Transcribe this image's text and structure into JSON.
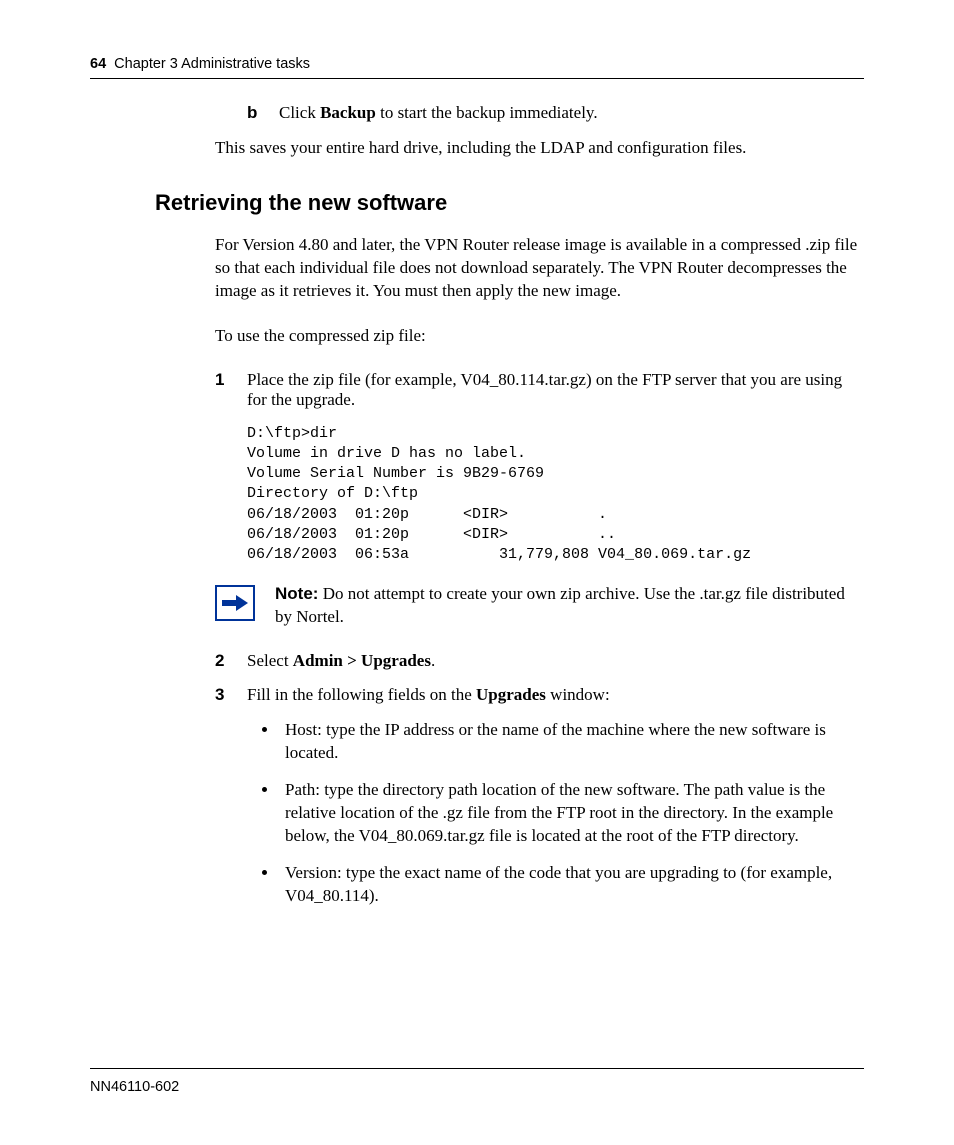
{
  "header": {
    "page_number": "64",
    "chapter": "Chapter 3  Administrative tasks"
  },
  "step_b": {
    "label": "b",
    "pre": "Click ",
    "bold": "Backup",
    "post": " to start the backup immediately."
  },
  "para_save": "This saves your entire hard drive, including the LDAP and configuration files.",
  "section_title": "Retrieving the new software",
  "para_intro": "For Version 4.80 and later, the VPN Router release image is available in a compressed .zip file so that each individual file does not download separately. The VPN Router decompresses the image as it retrieves it. You must then apply the new image.",
  "para_touse": "To use the compressed zip file:",
  "step1": {
    "label": "1",
    "text": "Place the zip file (for example, V04_80.114.tar.gz) on the FTP server that you are using for the upgrade."
  },
  "code_block": "D:\\ftp>dir\nVolume in drive D has no label.\nVolume Serial Number is 9B29-6769\nDirectory of D:\\ftp\n06/18/2003  01:20p      <DIR>          .\n06/18/2003  01:20p      <DIR>          ..\n06/18/2003  06:53a          31,779,808 V04_80.069.tar.gz",
  "note": {
    "label": "Note:",
    "text": " Do not attempt to create your own zip archive. Use the .tar.gz file distributed by Nortel."
  },
  "step2": {
    "label": "2",
    "pre": "Select ",
    "bold": "Admin > Upgrades",
    "post": "."
  },
  "step3": {
    "label": "3",
    "pre": "Fill in the following fields on the ",
    "bold": "Upgrades",
    "post": " window:"
  },
  "bullets": [
    "Host: type the IP address or the name of the machine where the new software is located.",
    "Path: type the directory path location of the new software. The path value is the relative location of the .gz file from the FTP root in the directory. In the example below, the V04_80.069.tar.gz file is located at the root of the FTP directory.",
    "Version: type the exact name of the code that you are upgrading to (for example, V04_80.114)."
  ],
  "footer": "NN46110-602"
}
